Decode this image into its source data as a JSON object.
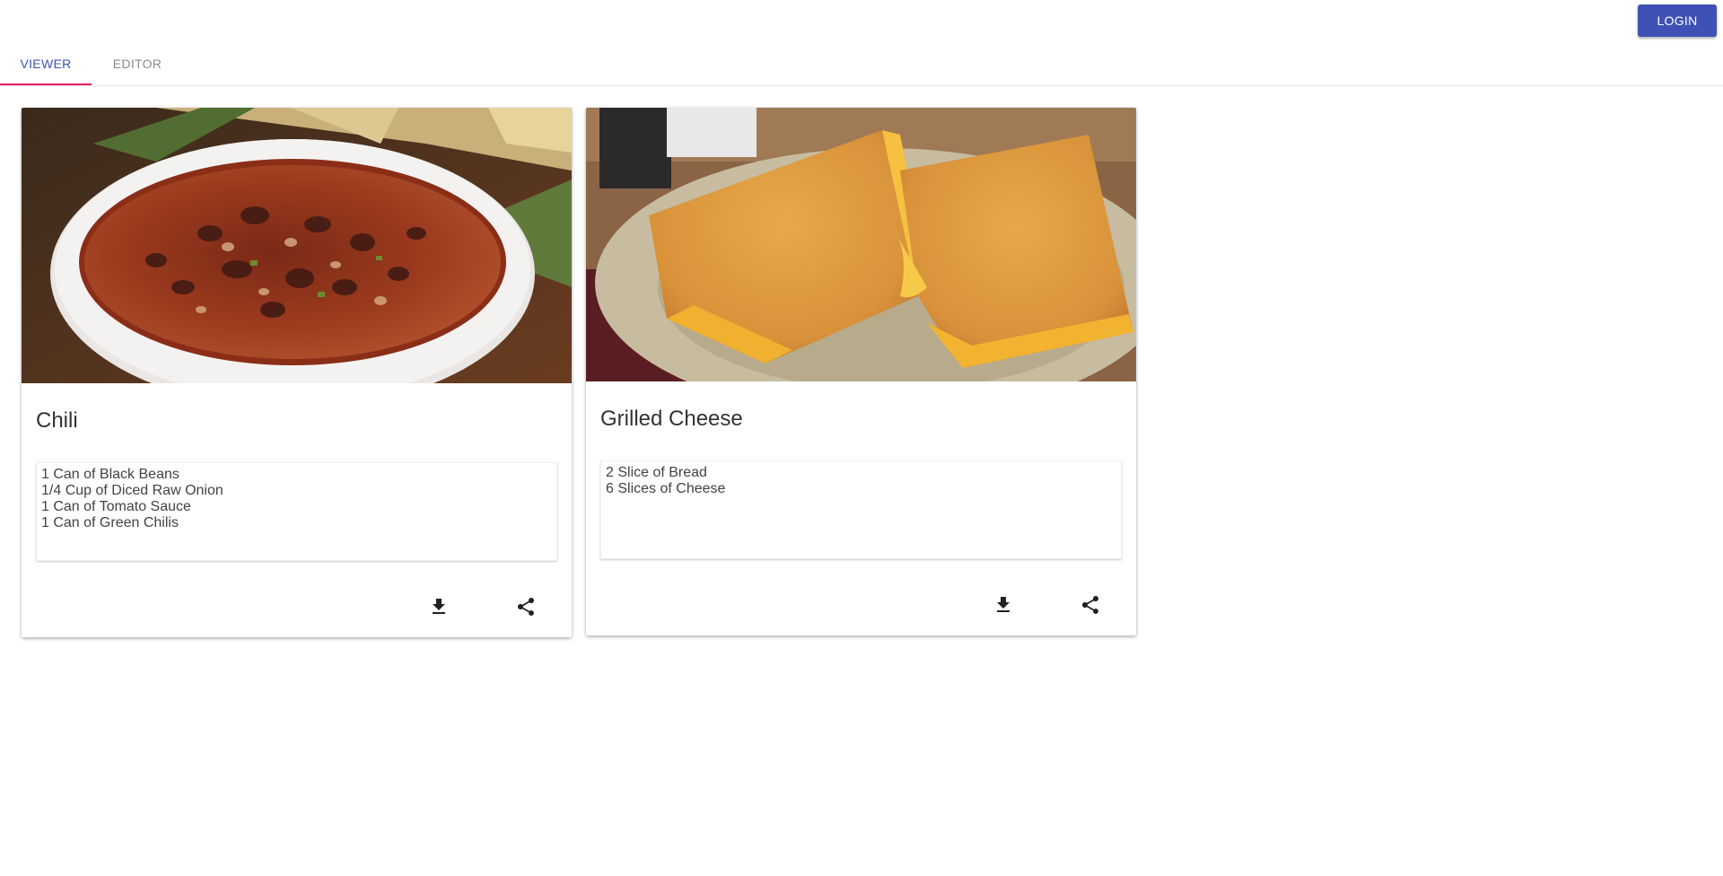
{
  "header": {
    "login_label": "LOGIN",
    "accent_color": "#3f51b5"
  },
  "tabs": [
    {
      "label": "VIEWER",
      "active": true
    },
    {
      "label": "EDITOR",
      "active": false
    }
  ],
  "tab_indicator_color": "#e91e63",
  "recipes": [
    {
      "title": "Chili",
      "image": "chili-bowl-photo",
      "ingredients": "1 Can of Black Beans\n1/4 Cup of Diced Raw Onion\n1 Can of Tomato Sauce\n1 Can of Green Chilis",
      "actions": [
        "download-icon",
        "share-icon"
      ]
    },
    {
      "title": "Grilled Cheese",
      "image": "grilled-cheese-photo",
      "ingredients": "2 Slice of Bread\n6 Slices of Cheese",
      "actions": [
        "download-icon",
        "share-icon"
      ]
    }
  ]
}
